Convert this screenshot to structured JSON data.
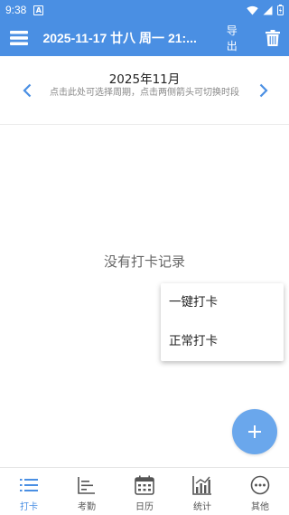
{
  "status_bar": {
    "time": "9:38",
    "notif_letter": "A"
  },
  "app_bar": {
    "title": "2025-11-17 廿八 周一 21:...",
    "export_label": "导出"
  },
  "period": {
    "title": "2025年11月",
    "hint": "点击此处可选择周期，点击两侧箭头可切换时段"
  },
  "empty_state": "没有打卡记录",
  "popup_menu": {
    "items": [
      {
        "label": "一键打卡"
      },
      {
        "label": "正常打卡"
      }
    ]
  },
  "bottom_nav": {
    "items": [
      {
        "label": "打卡",
        "icon": "list-icon",
        "active": true
      },
      {
        "label": "考勤",
        "icon": "attendance-icon"
      },
      {
        "label": "日历",
        "icon": "calendar-icon"
      },
      {
        "label": "统计",
        "icon": "stats-chart-icon"
      },
      {
        "label": "其他",
        "icon": "more-icon"
      }
    ]
  },
  "colors": {
    "primary": "#4a8fe3",
    "fab": "#6aa7ec",
    "active_tab": "#4a8fe3"
  }
}
